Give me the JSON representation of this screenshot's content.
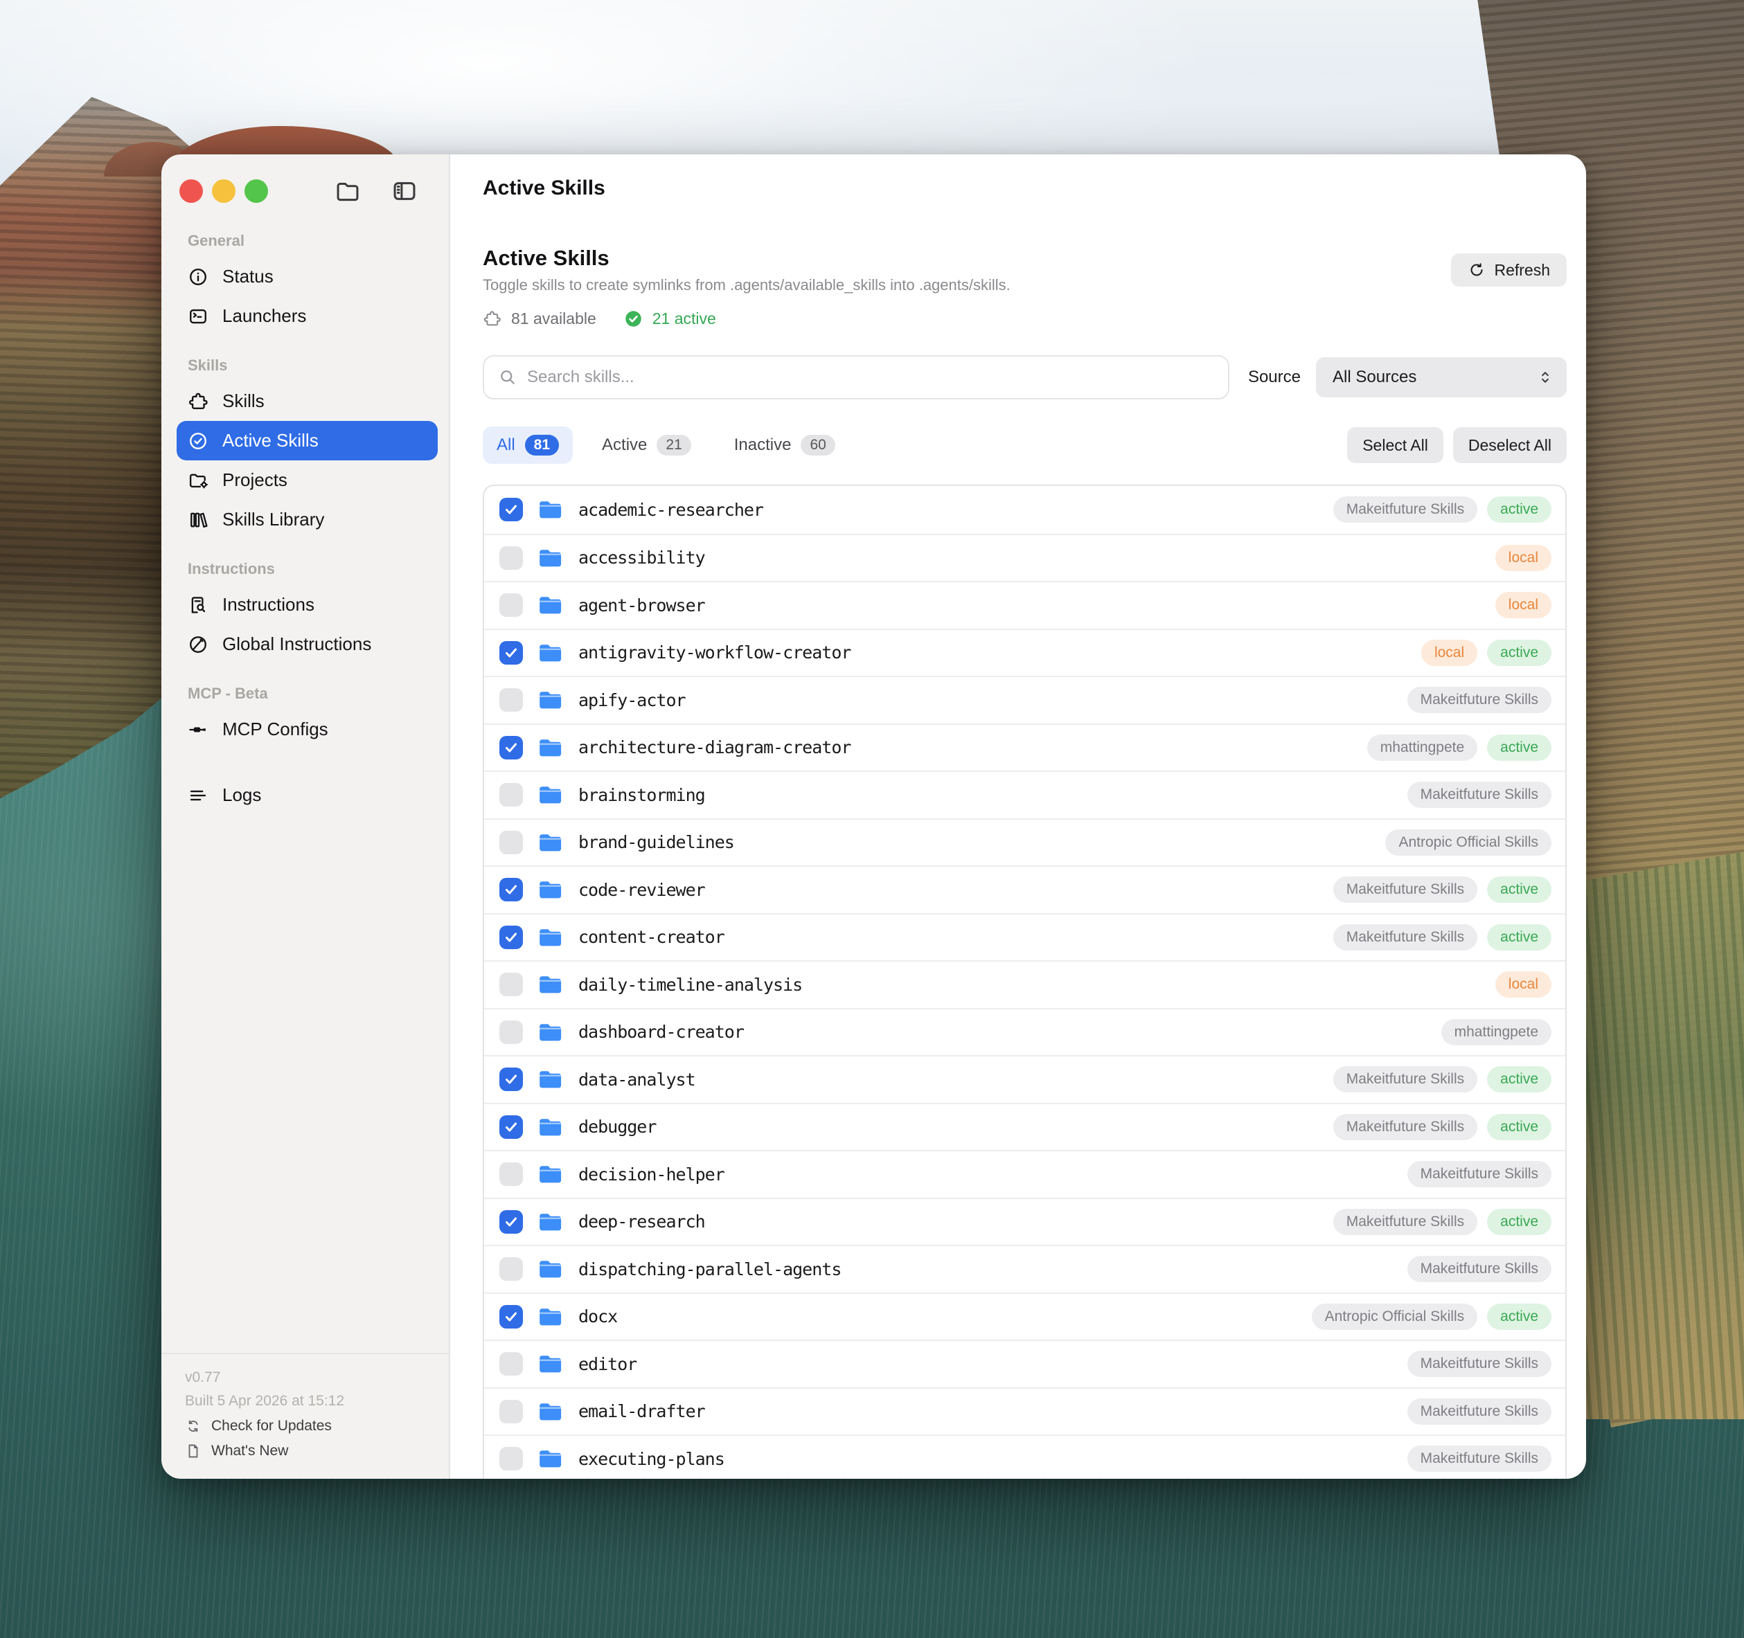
{
  "colors": {
    "accent": "#2f6ce6",
    "active_green": "#3aa855",
    "local_orange": "#e8863b",
    "sidebar_selected": "#3069e1",
    "folder_blue": "#3d8ef8"
  },
  "window": {
    "title": "Active Skills"
  },
  "sidebar": {
    "sections": [
      {
        "label": "General",
        "items": [
          {
            "label": "Status",
            "icon": "info-icon"
          },
          {
            "label": "Launchers",
            "icon": "terminal-icon"
          }
        ]
      },
      {
        "label": "Skills",
        "items": [
          {
            "label": "Skills",
            "icon": "puzzle-icon"
          },
          {
            "label": "Active Skills",
            "icon": "check-circle-icon",
            "active": true
          },
          {
            "label": "Projects",
            "icon": "folder-gear-icon"
          },
          {
            "label": "Skills Library",
            "icon": "books-icon"
          }
        ]
      },
      {
        "label": "Instructions",
        "items": [
          {
            "label": "Instructions",
            "icon": "document-search-icon"
          },
          {
            "label": "Global Instructions",
            "icon": "globe-slash-icon"
          }
        ]
      },
      {
        "label": "MCP - Beta",
        "items": [
          {
            "label": "MCP Configs",
            "icon": "plug-icon"
          }
        ]
      },
      {
        "label": "",
        "items": [
          {
            "label": "Logs",
            "icon": "lines-icon"
          }
        ]
      }
    ],
    "footer": {
      "version": "v0.77",
      "built": "Built 5 Apr 2026 at 15:12",
      "check_updates": "Check for Updates",
      "whats_new": "What's New"
    }
  },
  "header": {
    "title": "Active Skills",
    "description": "Toggle skills to create symlinks from .agents/available_skills into .agents/skills.",
    "refresh_label": "Refresh",
    "available_label": "81 available",
    "active_label": "21 active"
  },
  "controls": {
    "search_placeholder": "Search skills...",
    "source_label": "Source",
    "source_value": "All Sources",
    "tabs": [
      {
        "label": "All",
        "count": "81",
        "selected": true
      },
      {
        "label": "Active",
        "count": "21",
        "selected": false
      },
      {
        "label": "Inactive",
        "count": "60",
        "selected": false
      }
    ],
    "select_all": "Select All",
    "deselect_all": "Deselect All"
  },
  "skills": [
    {
      "name": "academic-researcher",
      "checked": true,
      "badges": [
        {
          "text": "Makeitfuture Skills",
          "type": "source"
        },
        {
          "text": "active",
          "type": "active"
        }
      ]
    },
    {
      "name": "accessibility",
      "checked": false,
      "badges": [
        {
          "text": "local",
          "type": "local"
        }
      ]
    },
    {
      "name": "agent-browser",
      "checked": false,
      "badges": [
        {
          "text": "local",
          "type": "local"
        }
      ]
    },
    {
      "name": "antigravity-workflow-creator",
      "checked": true,
      "badges": [
        {
          "text": "local",
          "type": "local"
        },
        {
          "text": "active",
          "type": "active"
        }
      ]
    },
    {
      "name": "apify-actor",
      "checked": false,
      "badges": [
        {
          "text": "Makeitfuture Skills",
          "type": "source"
        }
      ]
    },
    {
      "name": "architecture-diagram-creator",
      "checked": true,
      "badges": [
        {
          "text": "mhattingpete",
          "type": "source"
        },
        {
          "text": "active",
          "type": "active"
        }
      ]
    },
    {
      "name": "brainstorming",
      "checked": false,
      "badges": [
        {
          "text": "Makeitfuture Skills",
          "type": "source"
        }
      ]
    },
    {
      "name": "brand-guidelines",
      "checked": false,
      "badges": [
        {
          "text": "Antropic Official Skills",
          "type": "source"
        }
      ]
    },
    {
      "name": "code-reviewer",
      "checked": true,
      "badges": [
        {
          "text": "Makeitfuture Skills",
          "type": "source"
        },
        {
          "text": "active",
          "type": "active"
        }
      ]
    },
    {
      "name": "content-creator",
      "checked": true,
      "badges": [
        {
          "text": "Makeitfuture Skills",
          "type": "source"
        },
        {
          "text": "active",
          "type": "active"
        }
      ]
    },
    {
      "name": "daily-timeline-analysis",
      "checked": false,
      "badges": [
        {
          "text": "local",
          "type": "local"
        }
      ]
    },
    {
      "name": "dashboard-creator",
      "checked": false,
      "badges": [
        {
          "text": "mhattingpete",
          "type": "source"
        }
      ]
    },
    {
      "name": "data-analyst",
      "checked": true,
      "badges": [
        {
          "text": "Makeitfuture Skills",
          "type": "source"
        },
        {
          "text": "active",
          "type": "active"
        }
      ]
    },
    {
      "name": "debugger",
      "checked": true,
      "badges": [
        {
          "text": "Makeitfuture Skills",
          "type": "source"
        },
        {
          "text": "active",
          "type": "active"
        }
      ]
    },
    {
      "name": "decision-helper",
      "checked": false,
      "badges": [
        {
          "text": "Makeitfuture Skills",
          "type": "source"
        }
      ]
    },
    {
      "name": "deep-research",
      "checked": true,
      "badges": [
        {
          "text": "Makeitfuture Skills",
          "type": "source"
        },
        {
          "text": "active",
          "type": "active"
        }
      ]
    },
    {
      "name": "dispatching-parallel-agents",
      "checked": false,
      "badges": [
        {
          "text": "Makeitfuture Skills",
          "type": "source"
        }
      ]
    },
    {
      "name": "docx",
      "checked": true,
      "badges": [
        {
          "text": "Antropic Official Skills",
          "type": "source"
        },
        {
          "text": "active",
          "type": "active"
        }
      ]
    },
    {
      "name": "editor",
      "checked": false,
      "badges": [
        {
          "text": "Makeitfuture Skills",
          "type": "source"
        }
      ]
    },
    {
      "name": "email-drafter",
      "checked": false,
      "badges": [
        {
          "text": "Makeitfuture Skills",
          "type": "source"
        }
      ]
    },
    {
      "name": "executing-plans",
      "checked": false,
      "badges": [
        {
          "text": "Makeitfuture Skills",
          "type": "source"
        }
      ]
    }
  ]
}
